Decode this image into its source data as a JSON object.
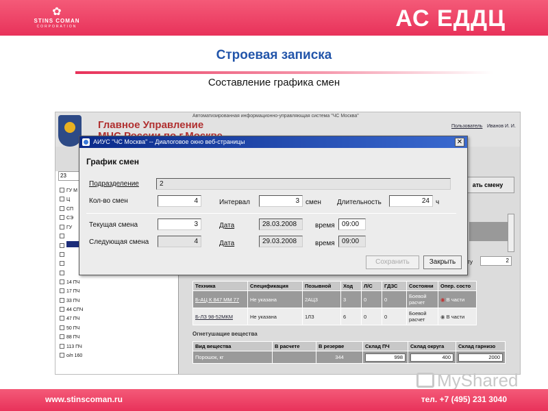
{
  "slide": {
    "logo_name": "STINS COMAN",
    "logo_corp": "CORPORATION",
    "brand": "АС ЕДДЦ",
    "title": "Строевая записка",
    "subtitle": "Составление графика смен",
    "footer_url": "www.stinscoman.ru",
    "footer_phone": "тел. +7 (495) 231 3040",
    "watermark": "MyShared",
    "accent_color": "#e8325a",
    "title_color": "#2255aa"
  },
  "app": {
    "system_name": "Автоматизированная информационно-управляющая система \"ЧС Москва\"",
    "org_line1": "Главное Управление",
    "org_line2": "МЧС России по г.Москве",
    "user_label": "Пользователь",
    "user_name": "Иванов И. И.",
    "combo_value": "23",
    "shift_button": "ать смену",
    "count_label": "ату",
    "count_value": "2",
    "tree": [
      {
        "label": "ГУ М"
      },
      {
        "label": "Ц"
      },
      {
        "label": "СП"
      },
      {
        "label": "СЭ"
      },
      {
        "label": "ГУ"
      },
      {
        "label": ""
      },
      {
        "label": ""
      },
      {
        "label": ""
      },
      {
        "label": ""
      },
      {
        "label": ""
      },
      {
        "label": "14 ПЧ"
      },
      {
        "label": "17 ПЧ"
      },
      {
        "label": "33 ПЧ"
      },
      {
        "label": "44 СПЧ"
      },
      {
        "label": "47 ПЧ"
      },
      {
        "label": "50 ПЧ"
      },
      {
        "label": "88 ПЧ"
      },
      {
        "label": "113 ПЧ"
      },
      {
        "label": "о/п 160"
      }
    ],
    "tech_table": {
      "headers": [
        "Техника",
        "Спецификация",
        "Позывной",
        "Ход",
        "Л/С",
        "ГДЗС",
        "Состояни",
        "Опер. состо"
      ],
      "rows": [
        {
          "tech": "Б-АЦ К 847 ММ 77",
          "spec": "Не указана",
          "call": "2АЦ3",
          "hod": "3",
          "ls": "0",
          "gdzs": "0",
          "state": "Боевой расчет",
          "oper": "В части"
        },
        {
          "tech": "Б-ЛЗ 98-52МКМ",
          "spec": "Не указана",
          "call": "1ЛЗ",
          "hod": "6",
          "ls": "0",
          "gdzs": "0",
          "state": "Боевой расчет",
          "oper": "В части"
        }
      ]
    },
    "substances_label": "Огнетушащие вещества",
    "subs_table": {
      "headers": [
        "Вид вещества",
        "В расчете",
        "В резерве",
        "Склад ПЧ",
        "Склад округа",
        "Склад гарнизо"
      ],
      "rows": [
        {
          "kind": "Порошок, кг",
          "calc": "",
          "reserve": "344",
          "pch": "998",
          "okrug": "400",
          "garn": "2000"
        }
      ]
    }
  },
  "dialog": {
    "title": "АИУС \"ЧС Москва\" -- Диалоговое окно веб-страницы",
    "close": "✕",
    "heading": "График смен",
    "subdivision_label": "Подразделение",
    "subdivision_value": "2",
    "shifts_count_label": "Кол-во смен",
    "shifts_count_value": "4",
    "interval_label": "Интервал",
    "interval_value": "3",
    "interval_unit": "смен",
    "duration_label": "Длительность",
    "duration_value": "24",
    "duration_unit": "ч",
    "current_label": "Текущая смена",
    "current_value": "3",
    "next_label": "Следующая смена",
    "next_value": "4",
    "date_label": "Дата",
    "current_date": "28.03.2008",
    "next_date": "29.03.2008",
    "time_label": "время",
    "current_time": "09:00",
    "next_time": "09:00",
    "save_label": "Сохранить",
    "close_label": "Закрыть"
  }
}
